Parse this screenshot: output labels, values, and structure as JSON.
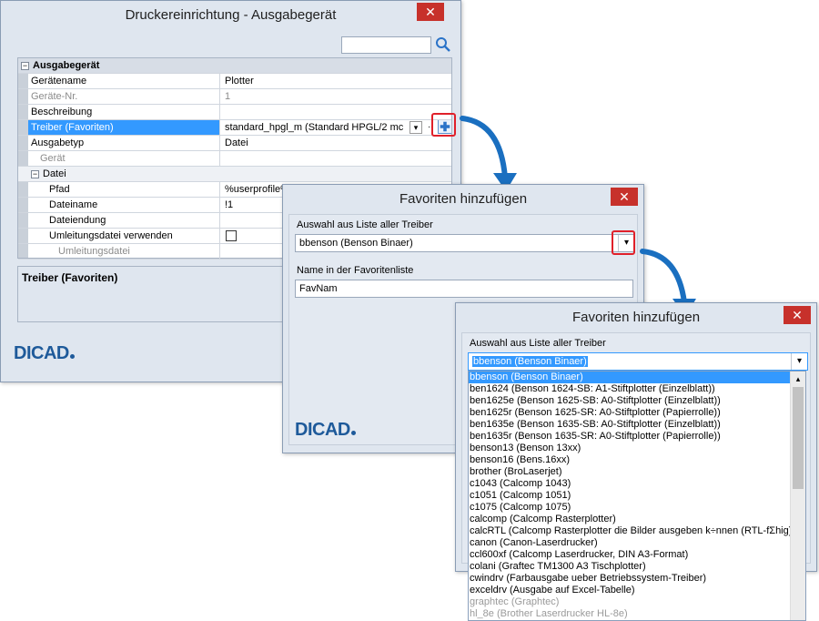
{
  "win1": {
    "title": "Druckereinrichtung - Ausgabegerät",
    "search": {
      "placeholder": ""
    },
    "rows": [
      {
        "label": "Ausgabegerät",
        "value": "",
        "type": "group"
      },
      {
        "label": "Gerätename",
        "value": "Plotter"
      },
      {
        "label": "Geräte-Nr.",
        "value": "1",
        "gray": true
      },
      {
        "label": "Beschreibung",
        "value": ""
      },
      {
        "label": "Treiber (Favoriten)",
        "value": "standard_hpgl_m (Standard HPGL/2 mc",
        "selected": true
      },
      {
        "label": "Ausgabetyp",
        "value": "Datei"
      },
      {
        "label": "Gerät",
        "value": "",
        "gray": true
      },
      {
        "label": "Datei",
        "value": "",
        "type": "subgroup"
      },
      {
        "label": "Pfad",
        "value": "%userprofile%"
      },
      {
        "label": "Dateiname",
        "value": "!1"
      },
      {
        "label": "Dateiendung",
        "value": ""
      },
      {
        "label": "Umleitungsdatei verwenden",
        "value": ""
      },
      {
        "label": "Umleitungsdatei",
        "value": "",
        "gray": true
      }
    ],
    "description_title": "Treiber (Favoriten)",
    "logo": "DICAD"
  },
  "win2": {
    "title": "Favoriten hinzufügen",
    "list_label": "Auswahl aus Liste aller Treiber",
    "combo_value": "bbenson (Benson Binaer)",
    "name_label": "Name in der Favoritenliste",
    "name_value": "FavNam",
    "logo": "DICAD"
  },
  "win3": {
    "title": "Favoriten hinzufügen",
    "list_label": "Auswahl aus Liste aller Treiber",
    "combo_value": "bbenson (Benson Binaer)",
    "items": [
      "bbenson (Benson Binaer)",
      "ben1624 (Benson 1624-SB: A1-Stiftplotter (Einzelblatt))",
      "ben1625e (Benson 1625-SB: A0-Stiftplotter (Einzelblatt))",
      "ben1625r (Benson 1625-SR: A0-Stiftplotter (Papierrolle))",
      "ben1635e (Benson 1635-SB: A0-Stiftplotter (Einzelblatt))",
      "ben1635r (Benson 1635-SR: A0-Stiftplotter (Papierrolle))",
      "benson13 (Benson 13xx)",
      "benson16 (Bens.16xx)",
      "brother (BroLaserjet)",
      "c1043 (Calcomp 1043)",
      "c1051 (Calcomp 1051)",
      "c1075 (Calcomp 1075)",
      "calcomp (Calcomp Rasterplotter)",
      "calcRTL (Calcomp Rasterplotter die Bilder ausgeben k÷nnen (RTL-fΣhig).)",
      "canon (Canon-Laserdrucker)",
      "ccl600xf (Calcomp Laserdrucker, DIN A3-Format)",
      "colani (Graftec TM1300 A3 Tischplotter)",
      "cwindrv (Farbausgabe ueber Betriebssystem-Treiber)",
      "exceldrv (Ausgabe auf Excel-Tabelle)",
      "graphtec (Graphtec)",
      "hl_8e (Brother Laserdrucker HL-8e)"
    ]
  },
  "colors": {
    "accent": "#3399ff",
    "close": "#c7312b",
    "highlight_box": "#e0202a",
    "arrow": "#1a6fc0"
  }
}
